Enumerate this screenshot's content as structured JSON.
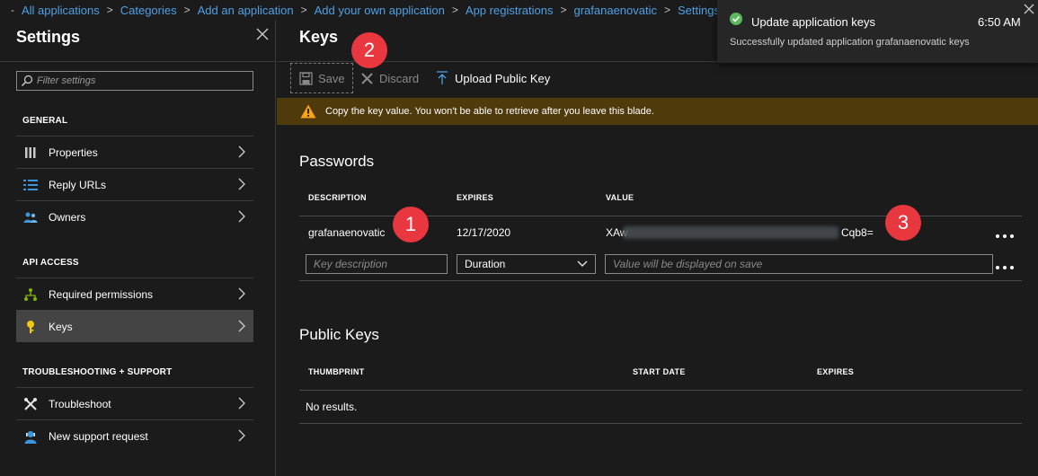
{
  "breadcrumb": [
    "All applications",
    "Categories",
    "Add an application",
    "Add your own application",
    "App registrations",
    "grafanaenovatic",
    "Settings"
  ],
  "settings": {
    "title": "Settings",
    "filter_placeholder": "Filter settings",
    "sections": {
      "general": "GENERAL",
      "api_access": "API ACCESS",
      "troubleshooting": "TROUBLESHOOTING + SUPPORT"
    },
    "items": {
      "properties": "Properties",
      "reply_urls": "Reply URLs",
      "owners": "Owners",
      "required_permissions": "Required permissions",
      "keys": "Keys",
      "troubleshoot": "Troubleshoot",
      "new_support_request": "New support request"
    }
  },
  "keys": {
    "title": "Keys",
    "toolbar": {
      "save": "Save",
      "discard": "Discard",
      "upload": "Upload Public Key"
    },
    "warning": "Copy the key value. You won't be able to retrieve after you leave this blade.",
    "passwords": {
      "heading": "Passwords",
      "columns": {
        "description": "DESCRIPTION",
        "expires": "EXPIRES",
        "value": "VALUE"
      },
      "row": {
        "description": "grafanaenovatic",
        "expires": "12/17/2020",
        "value_prefix": "XAw",
        "value_suffix": "Cqb8="
      },
      "new_row": {
        "description_placeholder": "Key description",
        "duration": "Duration",
        "value_placeholder": "Value will be displayed on save"
      }
    },
    "public_keys": {
      "heading": "Public Keys",
      "columns": {
        "thumbprint": "THUMBPRINT",
        "start_date": "START DATE",
        "expires": "EXPIRES"
      },
      "empty": "No results."
    }
  },
  "toast": {
    "title": "Update application keys",
    "time": "6:50 AM",
    "message": "Successfully updated application grafanaenovatic keys"
  },
  "callouts": {
    "one": "1",
    "two": "2",
    "three": "3"
  },
  "colors": {
    "link": "#4ea0e6",
    "warning_bg": "#4f3a0c",
    "warning_icon": "#f7a21b",
    "success": "#5cb85c",
    "callout": "#e8373e",
    "active_nav": "#444444"
  }
}
